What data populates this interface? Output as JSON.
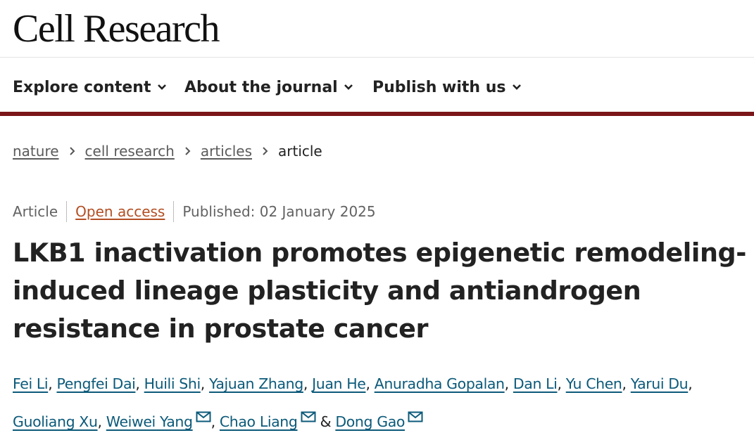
{
  "header": {
    "logo": "Cell Research"
  },
  "nav": {
    "items": [
      {
        "label": "Explore content",
        "icon": "chevron-down-icon"
      },
      {
        "label": "About the journal",
        "icon": "chevron-down-icon"
      },
      {
        "label": "Publish with us",
        "icon": "chevron-down-icon"
      }
    ],
    "accent_color": "#7a1519"
  },
  "breadcrumb": {
    "items": [
      "nature",
      "cell research",
      "articles"
    ],
    "current": "article"
  },
  "article": {
    "type": "Article",
    "access": "Open access",
    "published": "Published: 02 January 2025",
    "title": "LKB1 inactivation promotes epigenetic remodeling-induced lineage plasticity and antiandrogen resistance in prostate cancer",
    "authors": [
      "Fei Li",
      "Pengfei Dai",
      "Huili Shi",
      "Yajuan Zhang",
      "Juan He",
      "Anuradha Gopalan",
      "Dan Li",
      "Yu Chen",
      "Yarui Du",
      "Guoliang Xu",
      "Weiwei Yang",
      "Chao Liang",
      "Dong Gao"
    ],
    "separator": ",",
    "conjunction": "&",
    "link_color": "#0c5a7a",
    "open_access_color": "#b34e22"
  }
}
